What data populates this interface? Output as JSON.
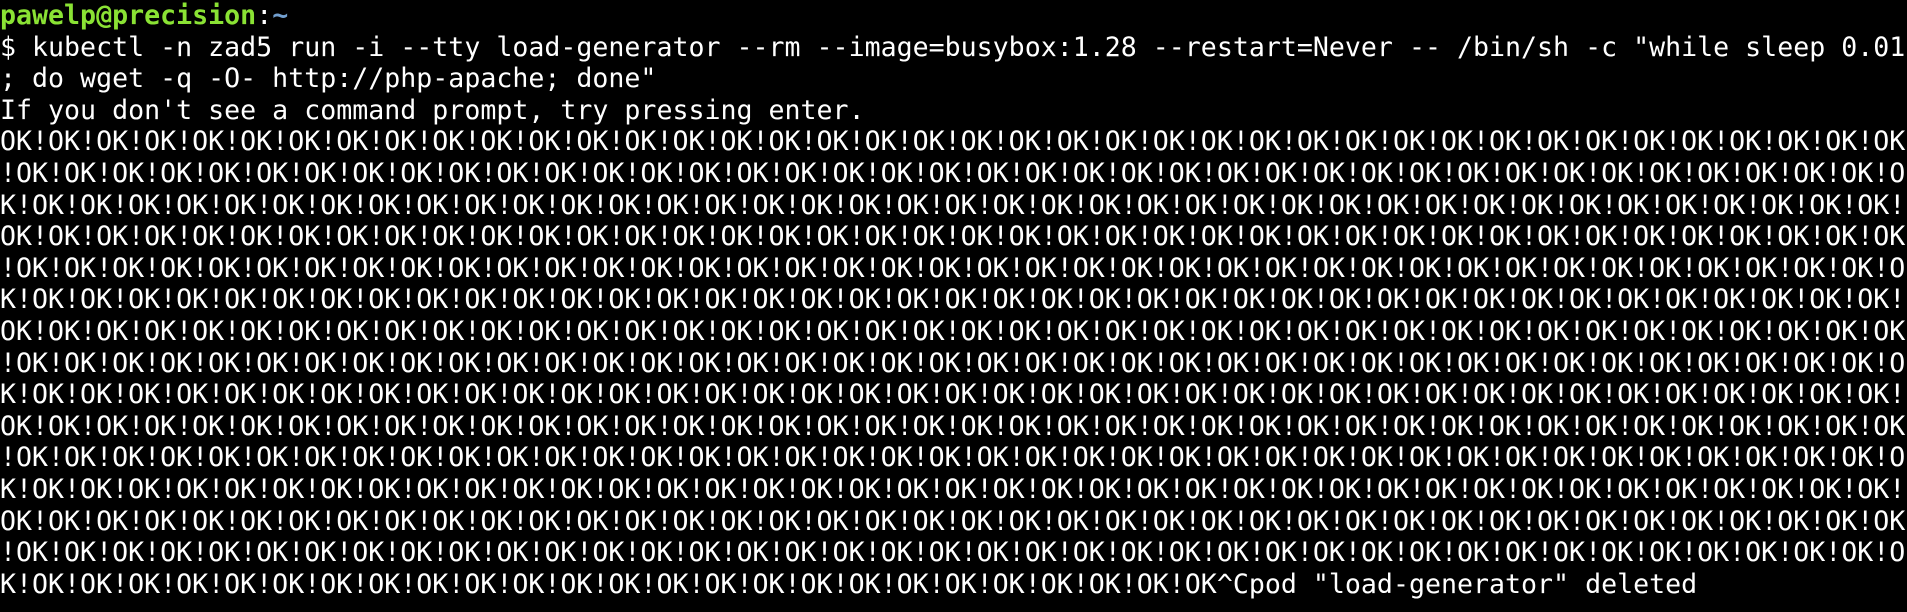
{
  "prompt": {
    "user_host": "pawelp@precision",
    "separator": ":",
    "path": "~"
  },
  "command_lines": [
    "$ kubectl -n zad5 run -i --tty load-generator --rm --image=busybox:1.28 --restart=Never -- /bin/sh -c \"while sleep 0.01",
    "; do wget -q -O- http://php-apache; done\""
  ],
  "hint": "If you don't see a command prompt, try pressing enter.",
  "output_lines": [
    "OK!OK!OK!OK!OK!OK!OK!OK!OK!OK!OK!OK!OK!OK!OK!OK!OK!OK!OK!OK!OK!OK!OK!OK!OK!OK!OK!OK!OK!OK!OK!OK!OK!OK!OK!OK!OK!OK!OK!OK",
    "!OK!OK!OK!OK!OK!OK!OK!OK!OK!OK!OK!OK!OK!OK!OK!OK!OK!OK!OK!OK!OK!OK!OK!OK!OK!OK!OK!OK!OK!OK!OK!OK!OK!OK!OK!OK!OK!OK!OK!O",
    "K!OK!OK!OK!OK!OK!OK!OK!OK!OK!OK!OK!OK!OK!OK!OK!OK!OK!OK!OK!OK!OK!OK!OK!OK!OK!OK!OK!OK!OK!OK!OK!OK!OK!OK!OK!OK!OK!OK!OK!",
    "OK!OK!OK!OK!OK!OK!OK!OK!OK!OK!OK!OK!OK!OK!OK!OK!OK!OK!OK!OK!OK!OK!OK!OK!OK!OK!OK!OK!OK!OK!OK!OK!OK!OK!OK!OK!OK!OK!OK!OK",
    "!OK!OK!OK!OK!OK!OK!OK!OK!OK!OK!OK!OK!OK!OK!OK!OK!OK!OK!OK!OK!OK!OK!OK!OK!OK!OK!OK!OK!OK!OK!OK!OK!OK!OK!OK!OK!OK!OK!OK!O",
    "K!OK!OK!OK!OK!OK!OK!OK!OK!OK!OK!OK!OK!OK!OK!OK!OK!OK!OK!OK!OK!OK!OK!OK!OK!OK!OK!OK!OK!OK!OK!OK!OK!OK!OK!OK!OK!OK!OK!OK!",
    "OK!OK!OK!OK!OK!OK!OK!OK!OK!OK!OK!OK!OK!OK!OK!OK!OK!OK!OK!OK!OK!OK!OK!OK!OK!OK!OK!OK!OK!OK!OK!OK!OK!OK!OK!OK!OK!OK!OK!OK",
    "!OK!OK!OK!OK!OK!OK!OK!OK!OK!OK!OK!OK!OK!OK!OK!OK!OK!OK!OK!OK!OK!OK!OK!OK!OK!OK!OK!OK!OK!OK!OK!OK!OK!OK!OK!OK!OK!OK!OK!O",
    "K!OK!OK!OK!OK!OK!OK!OK!OK!OK!OK!OK!OK!OK!OK!OK!OK!OK!OK!OK!OK!OK!OK!OK!OK!OK!OK!OK!OK!OK!OK!OK!OK!OK!OK!OK!OK!OK!OK!OK!",
    "OK!OK!OK!OK!OK!OK!OK!OK!OK!OK!OK!OK!OK!OK!OK!OK!OK!OK!OK!OK!OK!OK!OK!OK!OK!OK!OK!OK!OK!OK!OK!OK!OK!OK!OK!OK!OK!OK!OK!OK",
    "!OK!OK!OK!OK!OK!OK!OK!OK!OK!OK!OK!OK!OK!OK!OK!OK!OK!OK!OK!OK!OK!OK!OK!OK!OK!OK!OK!OK!OK!OK!OK!OK!OK!OK!OK!OK!OK!OK!OK!O",
    "K!OK!OK!OK!OK!OK!OK!OK!OK!OK!OK!OK!OK!OK!OK!OK!OK!OK!OK!OK!OK!OK!OK!OK!OK!OK!OK!OK!OK!OK!OK!OK!OK!OK!OK!OK!OK!OK!OK!OK!",
    "OK!OK!OK!OK!OK!OK!OK!OK!OK!OK!OK!OK!OK!OK!OK!OK!OK!OK!OK!OK!OK!OK!OK!OK!OK!OK!OK!OK!OK!OK!OK!OK!OK!OK!OK!OK!OK!OK!OK!OK",
    "!OK!OK!OK!OK!OK!OK!OK!OK!OK!OK!OK!OK!OK!OK!OK!OK!OK!OK!OK!OK!OK!OK!OK!OK!OK!OK!OK!OK!OK!OK!OK!OK!OK!OK!OK!OK!OK!OK!OK!O",
    "K!OK!OK!OK!OK!OK!OK!OK!OK!OK!OK!OK!OK!OK!OK!OK!OK!OK!OK!OK!OK!OK!OK!OK!OK!OK^Cpod \"load-generator\" deleted"
  ],
  "colors": {
    "background": "#000000",
    "foreground": "#ffffff",
    "user_host": "#8ae234",
    "path": "#729fcf"
  }
}
